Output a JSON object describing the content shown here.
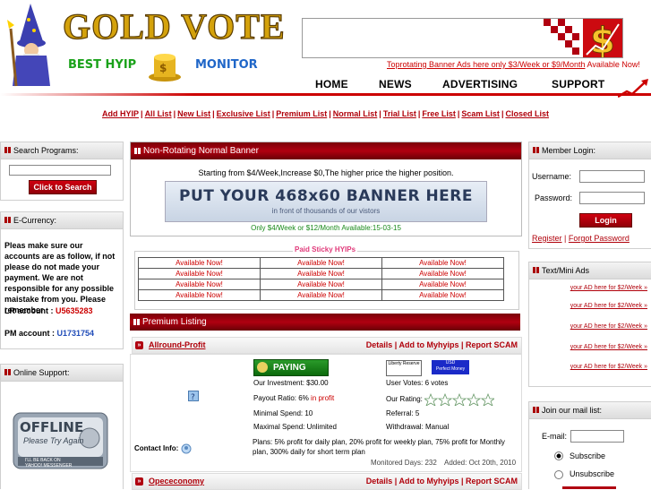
{
  "header": {
    "logo_title": "GOLD VOTE",
    "logo_sub_left": "BEST HYIP",
    "logo_sub_right": "MONITOR",
    "toprot_link": "Toprotating Banner Ads here only $3/Week or $9/Month",
    "toprot_available": "Available Now!",
    "nav": [
      "HOME",
      "NEWS",
      "ADVERTISING",
      "SUPPORT"
    ]
  },
  "linkbar": [
    "Add HYIP",
    "All List",
    "New List",
    "Exclusive List",
    "Premium List",
    "Normal List",
    "Trial List",
    "Free List",
    "Scam List",
    "Closed List"
  ],
  "search": {
    "title": "Search Programs:",
    "button": "Click to Search",
    "placeholder": ""
  },
  "currency": {
    "title": "E-Currency:",
    "notice": "Pleas make sure our accounts are as follow, if not please do not made your payment. We are not responsible for any possible maistake from you. Please remember",
    "lr_label": "LR account : ",
    "lr_value": "U5635283",
    "pm_label": "PM account : ",
    "pm_value": "U1731754"
  },
  "support": {
    "title": "Online Support:",
    "offline": "OFFLINE",
    "offline_sub": "Please Try Again",
    "offline_back": "I'LL BE BACK ON",
    "offline_msgr": "YAHOO! MESSENGER"
  },
  "normal_banner": {
    "title": "Non-Rotating Normal Banner",
    "price": "Starting from $4/Week,Increase $0,The higher price the higher position.",
    "banner_main": "PUT YOUR 468x60 BANNER HERE",
    "banner_sub": "in front of thousands of our vistors",
    "offer": "Only $4/Week or $12/Month Available:15-03-15"
  },
  "sticky": {
    "title": "Paid Sticky HYIPs",
    "cells": [
      "Available Now!",
      "Available Now!",
      "Available Now!",
      "Available Now!",
      "Available Now!",
      "Available Now!",
      "Available Now!",
      "Available Now!",
      "Available Now!",
      "Available Now!",
      "Available Now!",
      "Available Now!"
    ]
  },
  "premium": {
    "title": "Premium Listing",
    "program": {
      "name": "Allround-Profit",
      "links": [
        "Details",
        "Add to Myhyips",
        "Report SCAM"
      ],
      "status": "PAYING",
      "investment": "Our Investment: $30.00",
      "votes": "User Votes: 6 votes",
      "payout_label": "Payout Ratio: 6%",
      "payout_status": " in profit",
      "rating_label": "Our Rating:",
      "min_spend": "Minimal Spend: 10",
      "referral": "Referral: 5",
      "max_spend": "Maximal Spend: Unlimited",
      "withdrawal": "Withdrawal: Manual",
      "contact": "Contact Info:",
      "plans": "Plans: 5% profit for daily plan, 20% profit for weekly plan, 75% profit for Monthly plan, 300% daily for short term plan",
      "monitored": "Monitored Days: 232",
      "added": "Added: Oct 20th, 2010",
      "lr_logo": "Liberty Reserve",
      "pm_logo": "Perfect Money",
      "usd": "USD"
    },
    "program2": {
      "name": "Opececonomy",
      "links": [
        "Details",
        "Add to Myhyips",
        "Report SCAM"
      ]
    }
  },
  "login": {
    "title": "Member Login:",
    "user_label": "Username:",
    "pass_label": "Password:",
    "button": "Login",
    "register": "Register",
    "forgot": "Forgot Password"
  },
  "textads": {
    "title": "Text/Mini Ads",
    "items": [
      "your AD here for $2/Week »",
      "your AD here for $2/Week »",
      "your AD here for $2/Week »",
      "your AD here for $2/Week »",
      "your AD here for $2/Week »"
    ]
  },
  "maillist": {
    "title": "Join our mail list:",
    "email_label": "E-mail:",
    "subscribe": "Subscribe",
    "unsubscribe": "Unsubscribe"
  }
}
